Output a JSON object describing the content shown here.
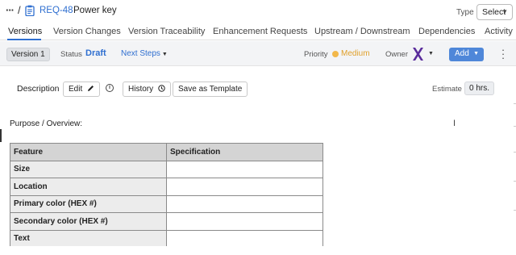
{
  "breadcrumb": {
    "more": "···",
    "separator": "/",
    "req_id": "REQ-48",
    "title": "Power key",
    "type_label": "Type",
    "type_value": "Select"
  },
  "tabs": [
    {
      "label": "Versions",
      "active": true
    },
    {
      "label": "Version Changes"
    },
    {
      "label": "Version Traceability"
    },
    {
      "label": "Enhancement Requests"
    },
    {
      "label": "Upstream / Downstream"
    },
    {
      "label": "Dependencies"
    },
    {
      "label": "Activity"
    }
  ],
  "version_bar": {
    "version": "Version 1",
    "status_label": "Status",
    "status_value": "Draft",
    "next_steps": "Next Steps",
    "priority_label": "Priority",
    "priority_value": "Medium",
    "owner_label": "Owner",
    "add_label": "Add"
  },
  "description": {
    "label": "Description",
    "edit_label": "Edit",
    "history_label": "History",
    "save_template_label": "Save as Template",
    "estimate_label": "Estimate",
    "estimate_value": "0 hrs."
  },
  "content": {
    "purpose": "Purpose / Overview:"
  },
  "feature_table": {
    "headers": [
      "Feature",
      "Specification"
    ],
    "rows": [
      {
        "feature": "Size",
        "spec": ""
      },
      {
        "feature": "Location",
        "spec": ""
      },
      {
        "feature": "Primary color (HEX #)",
        "spec": ""
      },
      {
        "feature": "Secondary color (HEX #)",
        "spec": ""
      },
      {
        "feature": "Text",
        "spec": ""
      }
    ]
  },
  "colors": {
    "accent": "#2f6fd0",
    "add_button": "#4f87d9",
    "priority_medium": "#f2b84b",
    "owner_avatar": "#5a2d9c"
  },
  "icons": {
    "req": "clipboard-icon",
    "edit": "pencil-icon",
    "info": "info-icon",
    "history": "clock-icon",
    "menu": "kebab-icon"
  }
}
